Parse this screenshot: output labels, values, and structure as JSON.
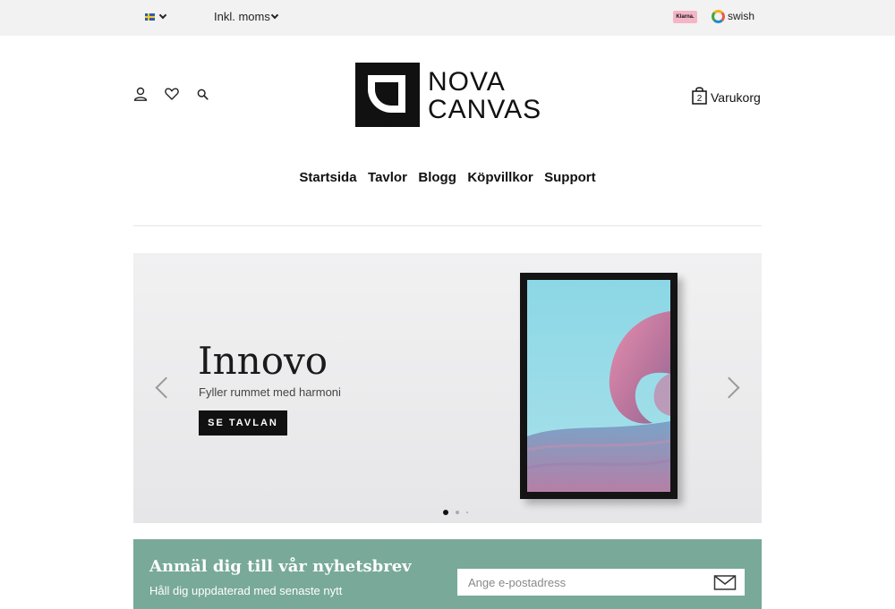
{
  "topbar": {
    "language_icon": "sweden-flag-icon",
    "vat_label": "Inkl. moms",
    "payment_badges": {
      "klarna": "Klarna.",
      "swish": "swish"
    }
  },
  "header": {
    "icons": [
      "user-icon",
      "heart-icon",
      "search-icon"
    ],
    "logo": {
      "line1": "NOVA",
      "line2": "CANVAS"
    },
    "cart": {
      "count": "2",
      "label": "Varukorg"
    }
  },
  "nav": {
    "items": [
      "Startsida",
      "Tavlor",
      "Blogg",
      "Köpvillkor",
      "Support"
    ]
  },
  "hero": {
    "title": "Innovo",
    "subtitle": "Fyller rummet med harmoni",
    "button_label": "SE TAVLAN",
    "slide_count": 3,
    "active_slide": 1
  },
  "newsletter": {
    "title": "Anmäl dig till vår nyhetsbrev",
    "subtitle": "Håll dig uppdaterad med senaste nytt",
    "input_placeholder": "Ange e-postadress",
    "submit_icon": "envelope-icon"
  },
  "colors": {
    "topbar_bg": "#f2f2f2",
    "newsletter_bg": "#78a999",
    "button_bg": "#111111",
    "klarna_pink": "#f4b6c7"
  }
}
